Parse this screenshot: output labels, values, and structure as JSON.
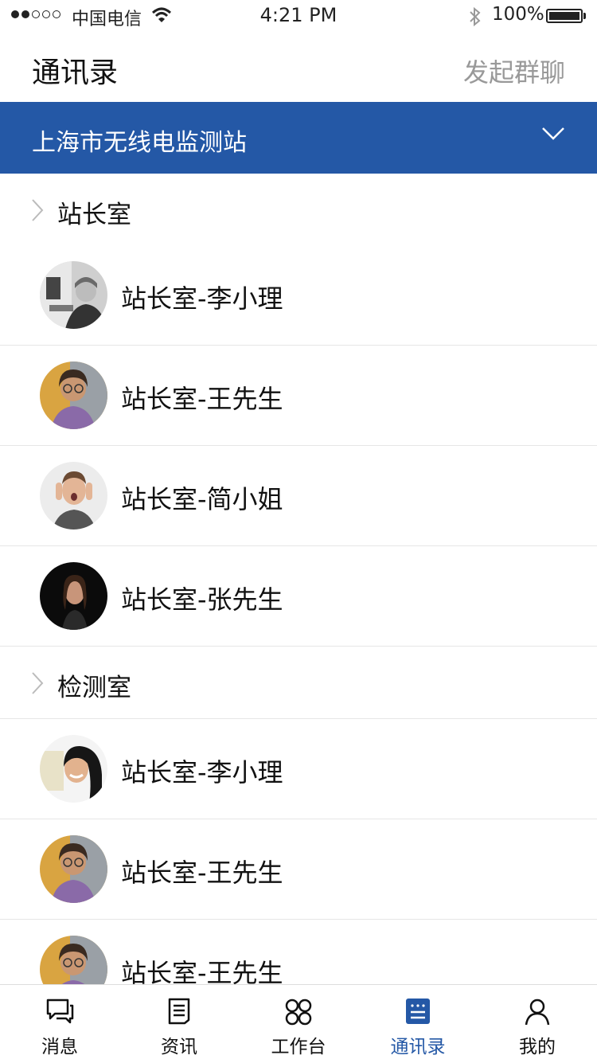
{
  "status_bar": {
    "carrier": "中国电信",
    "time": "4:21 PM",
    "battery": "100%"
  },
  "header": {
    "title": "通讯录",
    "action": "发起群聊"
  },
  "org_selector": {
    "name": "上海市无线电监测站",
    "color": "#2458a6"
  },
  "groups": [
    {
      "label": "站长室",
      "contacts": [
        "站长室-李小理",
        "站长室-王先生",
        "站长室-简小姐",
        "站长室-张先生"
      ]
    },
    {
      "label": "检测室",
      "contacts": [
        "站长室-李小理",
        "站长室-王先生",
        "站长室-王先生"
      ]
    }
  ],
  "tabs": [
    {
      "label": "消息",
      "icon": "message-icon"
    },
    {
      "label": "资讯",
      "icon": "news-icon"
    },
    {
      "label": "工作台",
      "icon": "workbench-icon"
    },
    {
      "label": "通讯录",
      "icon": "contacts-icon",
      "active": true
    },
    {
      "label": "我的",
      "icon": "profile-icon"
    }
  ]
}
